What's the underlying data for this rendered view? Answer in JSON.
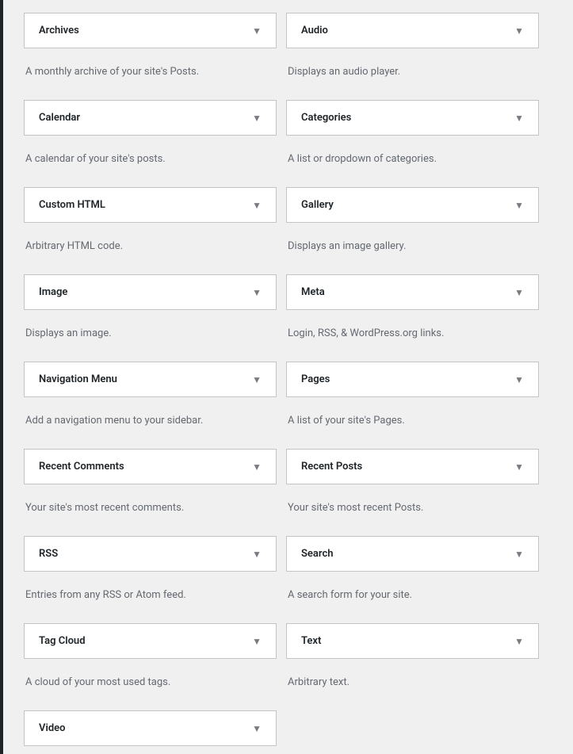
{
  "widgets": [
    {
      "title": "Archives",
      "desc": "A monthly archive of your site's Posts."
    },
    {
      "title": "Audio",
      "desc": "Displays an audio player."
    },
    {
      "title": "Calendar",
      "desc": "A calendar of your site's posts."
    },
    {
      "title": "Categories",
      "desc": "A list or dropdown of categories."
    },
    {
      "title": "Custom HTML",
      "desc": "Arbitrary HTML code."
    },
    {
      "title": "Gallery",
      "desc": "Displays an image gallery."
    },
    {
      "title": "Image",
      "desc": "Displays an image."
    },
    {
      "title": "Meta",
      "desc": "Login, RSS, & WordPress.org links."
    },
    {
      "title": "Navigation Menu",
      "desc": "Add a navigation menu to your sidebar."
    },
    {
      "title": "Pages",
      "desc": "A list of your site's Pages."
    },
    {
      "title": "Recent Comments",
      "desc": "Your site's most recent comments."
    },
    {
      "title": "Recent Posts",
      "desc": "Your site's most recent Posts."
    },
    {
      "title": "RSS",
      "desc": "Entries from any RSS or Atom feed."
    },
    {
      "title": "Search",
      "desc": "A search form for your site."
    },
    {
      "title": "Tag Cloud",
      "desc": "A cloud of your most used tags."
    },
    {
      "title": "Text",
      "desc": "Arbitrary text."
    },
    {
      "title": "Video",
      "desc": ""
    }
  ]
}
